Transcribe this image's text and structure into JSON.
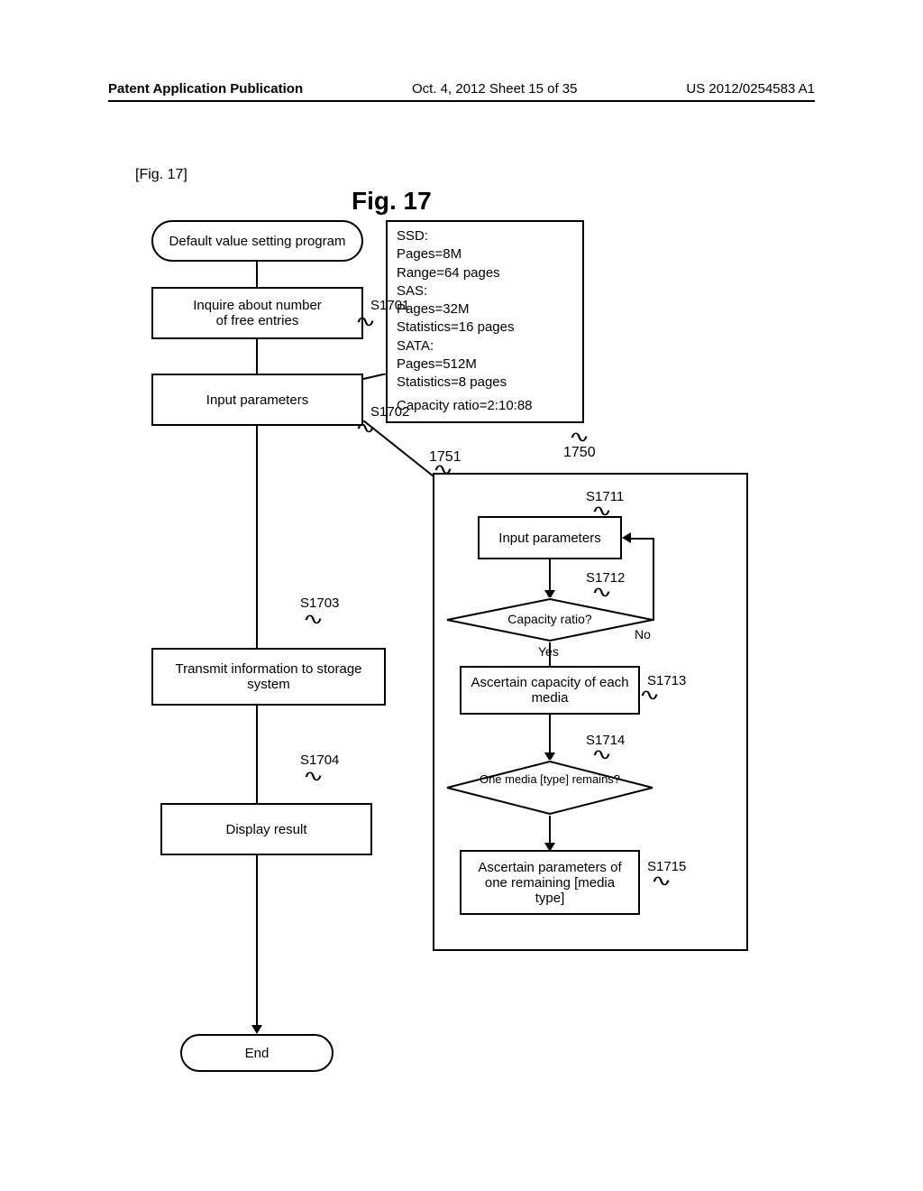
{
  "header": {
    "left": "Patent Application Publication",
    "center": "Oct. 4, 2012  Sheet 15 of 35",
    "right": "US 2012/0254583 A1"
  },
  "fig_label_small": "[Fig. 17]",
  "fig_label_large": "Fig. 17",
  "start_box": "Default value setting program",
  "step1": {
    "label": "S1701",
    "text": "Inquire about number\nof free entries"
  },
  "step2": {
    "label": "S1702",
    "text": "Input parameters"
  },
  "step3": {
    "label": "S1703",
    "text": "Transmit information to storage system"
  },
  "step4": {
    "label": "S1704",
    "text": "Display result"
  },
  "end_box": "End",
  "info": {
    "lines": [
      "SSD:",
      "Pages=8M",
      "Range=64 pages",
      "SAS:",
      "Pages=32M",
      "Statistics=16 pages",
      "SATA:",
      "Pages=512M",
      "Statistics=8 pages",
      "",
      "Capacity ratio=2:10:88"
    ]
  },
  "ref1750": "1750",
  "ref1751": "1751",
  "sub": {
    "s1711": {
      "label": "S1711",
      "text": "Input parameters"
    },
    "s1712": {
      "label": "S1712",
      "text": "Capacity ratio?"
    },
    "s1713": {
      "label": "S1713",
      "text": "Ascertain capacity of each media"
    },
    "s1714": {
      "label": "S1714",
      "text": "One media [type] remains?"
    },
    "s1715": {
      "label": "S1715",
      "text": "Ascertain parameters of one remaining [media type]"
    },
    "yes": "Yes",
    "no": "No"
  },
  "chart_data": {
    "type": "table",
    "note": "flowchart diagram, not a quantitative chart; parameter block contents captured in info.lines"
  }
}
